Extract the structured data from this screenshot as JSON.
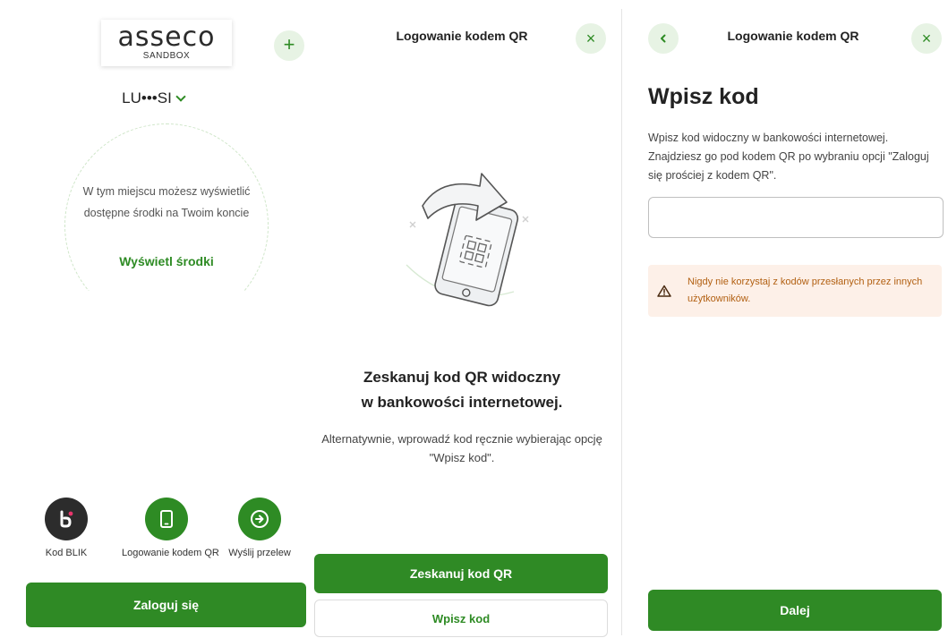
{
  "colors": {
    "accent": "#2e8b24",
    "accent_light": "#e7f3e4",
    "warning_bg": "#fdf0e8",
    "warning_text": "#b26012"
  },
  "home": {
    "logo": {
      "text": "asseco",
      "subtitle": "SANDBOX"
    },
    "add_icon": "+",
    "user_name": "LU•••SI",
    "balance_info": "W tym miejscu możesz wyświetlić dostępne środki na Twoim koncie",
    "show_funds_link": "Wyświetl środki",
    "quick_actions": [
      {
        "label": "Kod BLIK",
        "icon": "blik-icon"
      },
      {
        "label": "Logowanie kodem QR",
        "icon": "phone-icon"
      },
      {
        "label": "Wyślij przelew",
        "icon": "arrow-right-icon"
      }
    ],
    "login_button": "Zaloguj się"
  },
  "qr_scan": {
    "title": "Logowanie kodem QR",
    "close_icon": "×",
    "heading_line1": "Zeskanuj kod QR widoczny",
    "heading_line2": "w bankowości internetowej.",
    "description": "Alternatywnie, wprowadź kod ręcznie wybierając opcję \"Wpisz kod\".",
    "scan_button": "Zeskanuj kod QR",
    "enter_code_button": "Wpisz kod"
  },
  "enter_code": {
    "title": "Logowanie kodem QR",
    "close_icon": "×",
    "heading": "Wpisz kod",
    "description": "Wpisz kod widoczny w bankowości internetowej. Znajdziesz go pod kodem QR po wybraniu opcji \"Zaloguj się prościej z kodem QR\".",
    "code_value": "",
    "warning": "Nigdy nie korzystaj z kodów przesłanych przez innych użytkowników.",
    "next_button": "Dalej"
  }
}
